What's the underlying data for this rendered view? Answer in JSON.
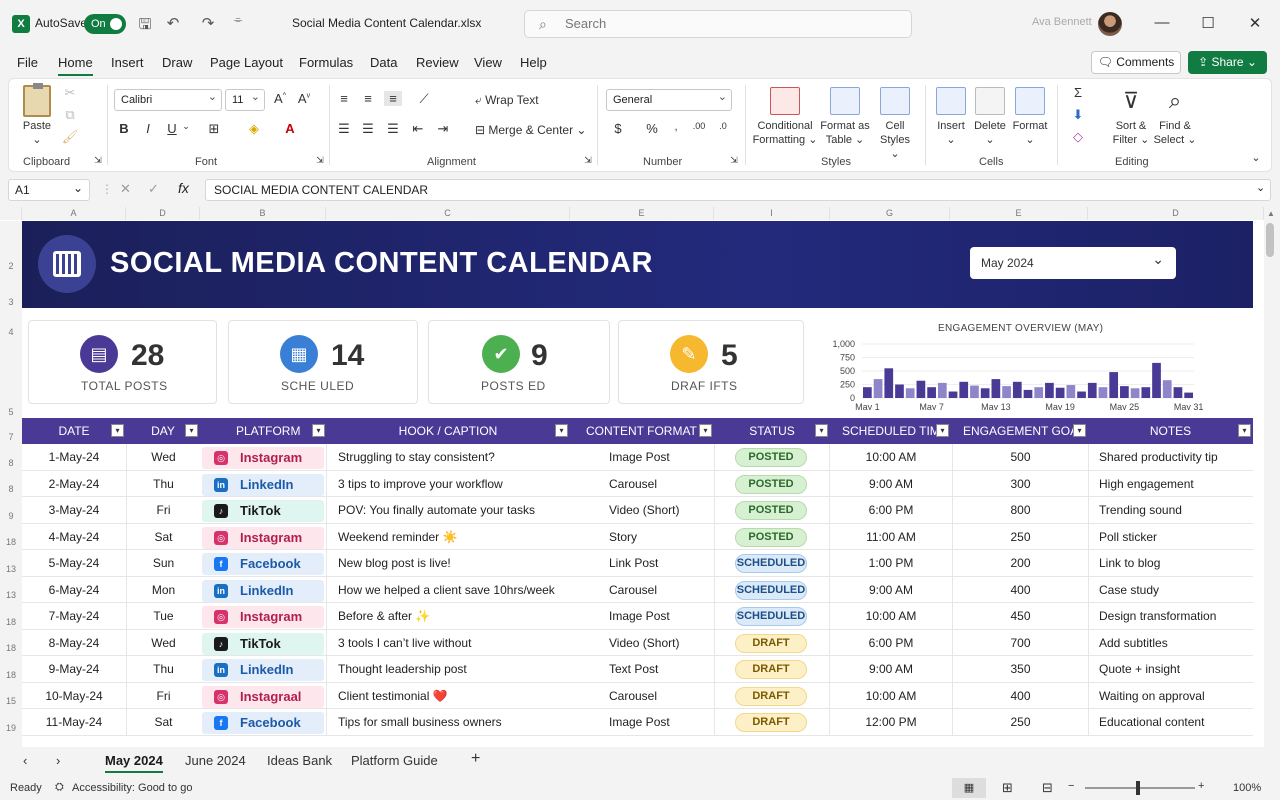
{
  "titlebar": {
    "autosave_label": "AutoSave",
    "autosave_state": "On",
    "filename": "Social Media Content Calendar.xlsx",
    "search_placeholder": "Search",
    "user_name": "Ava Bennett"
  },
  "menu": {
    "items": [
      "File",
      "Home",
      "Insert",
      "Draw",
      "Page Layout",
      "Formulas",
      "Data",
      "Review",
      "View",
      "Help"
    ],
    "active": "Home",
    "comments": "Comments",
    "share": "Share"
  },
  "ribbon": {
    "clipboard": {
      "paste": "Paste",
      "label": "Clipboard"
    },
    "font": {
      "family": "Calibri",
      "size": "11",
      "label": "Font"
    },
    "alignment": {
      "wrap": "Wrap Text",
      "merge": "Merge & Center",
      "label": "Alignment"
    },
    "number": {
      "format": "General",
      "label": "Number"
    },
    "styles": {
      "cond": "Conditional Formatting",
      "table": "Format as Table",
      "cell": "Cell Styles",
      "label": "Styles"
    },
    "cells": {
      "insert": "Insert",
      "delete": "Delete",
      "format": "Format",
      "label": "Cells"
    },
    "editing": {
      "sort": "Sort & Filter",
      "find": "Find & Select",
      "label": "Editing"
    }
  },
  "formula_bar": {
    "cell": "A1",
    "fx": "fx",
    "value": "SOCIAL MEDIA CONTENT CALENDAR"
  },
  "grid": {
    "col_headers": [
      "A",
      "D",
      "B",
      "C",
      "E",
      "I",
      "G",
      "E",
      "D"
    ],
    "row_headers": [
      "2",
      "3",
      "4",
      "5",
      "7",
      "8",
      "8",
      "9",
      "18",
      "13",
      "13",
      "18",
      "18",
      "18",
      "15",
      "19"
    ],
    "banner_title": "SOCIAL MEDIA CONTENT CALENDAR",
    "month": "May 2024",
    "kpis": [
      {
        "value": "28",
        "label": "TOTAL   POSTS",
        "color": "#4a3a96",
        "icon": "document-icon"
      },
      {
        "value": "14",
        "label": "SCHE    ULED",
        "color": "#3a7fd6",
        "icon": "calendar-icon"
      },
      {
        "value": "9",
        "label": "POSTS    ED",
        "color": "#4caf50",
        "icon": "check-icon"
      },
      {
        "value": "5",
        "label": "DRAF   IFTS",
        "color": "#f5b82e",
        "icon": "pencil-icon"
      }
    ],
    "headers": [
      "DATE",
      "DAY",
      "PLATFORM",
      "HOOK / CAPTION",
      "CONTENT FORMAT",
      "STATUS",
      "SCHEDULED TIME",
      "ENGAGEMENT GOAL",
      "NOTES"
    ],
    "rows": [
      {
        "date": "1-May-24",
        "day": "Wed",
        "platform": "Instagram",
        "caption": "Struggling to stay consistent?",
        "format": "Image Post",
        "status": "POSTED",
        "time": "10:00 AM",
        "goal": "500",
        "notes": "Shared productivity tip"
      },
      {
        "date": "2-May-24",
        "day": "Thu",
        "platform": "LinkedIn",
        "caption": "3 tips to improve your workflow",
        "format": "Carousel",
        "status": "POSTED",
        "time": "9:00 AM",
        "goal": "300",
        "notes": "High engagement"
      },
      {
        "date": "3-May-24",
        "day": "Fri",
        "platform": "TikTok",
        "caption": "POV: You finally automate your tasks",
        "format": "Video (Short)",
        "status": "POSTED",
        "time": "6:00 PM",
        "goal": "800",
        "notes": "Trending sound"
      },
      {
        "date": "4-May-24",
        "day": "Sat",
        "platform": "Instagram",
        "caption": "Weekend reminder ☀️",
        "format": "Story",
        "status": "POSTED",
        "time": "11:00 AM",
        "goal": "250",
        "notes": "Poll sticker"
      },
      {
        "date": "5-May-24",
        "day": "Sun",
        "platform": "Facebook",
        "caption": "New blog post is live!",
        "format": "Link Post",
        "status": "SCHEDULED",
        "time": "1:00 PM",
        "goal": "200",
        "notes": "Link to blog"
      },
      {
        "date": "6-May-24",
        "day": "Mon",
        "platform": "LinkedIn",
        "caption": "How we helped a client save 10hrs/week",
        "format": "Carousel",
        "status": "SCHEDULED",
        "time": "9:00 AM",
        "goal": "400",
        "notes": "Case study"
      },
      {
        "date": "7-May-24",
        "day": "Tue",
        "platform": "Instagram",
        "caption": "Before & after ✨",
        "format": "Image Post",
        "status": "SCHEDULED",
        "time": "10:00 AM",
        "goal": "450",
        "notes": "Design transformation"
      },
      {
        "date": "8-May-24",
        "day": "Wed",
        "platform": "TikTok",
        "caption": "3 tools I can’t live without",
        "format": "Video (Short)",
        "status": "DRAFT",
        "time": "6:00 PM",
        "goal": "700",
        "notes": "Add subtitles"
      },
      {
        "date": "9-May-24",
        "day": "Thu",
        "platform": "LinkedIn",
        "caption": "Thought leadership post",
        "format": "Text Post",
        "status": "DRAFT",
        "time": "9:00 AM",
        "goal": "350",
        "notes": "Quote + insight"
      },
      {
        "date": "10-May-24",
        "day": "Fri",
        "platform": "Instagraal",
        "caption": "Client testimonial ❤️",
        "format": "Carousel",
        "status": "DRAFT",
        "time": "10:00 AM",
        "goal": "400",
        "notes": "Waiting on approval"
      },
      {
        "date": "11-May-24",
        "day": "Sat",
        "platform": "Facebook",
        "caption": "Tips for small business owners",
        "format": "Image Post",
        "status": "DRAFT",
        "time": "12:00 PM",
        "goal": "250",
        "notes": "Educational content"
      }
    ]
  },
  "chart_data": {
    "type": "bar",
    "title": "ENGAGEMENT OVERVIEW (MAY)",
    "xticks": [
      "May 1",
      "May 7",
      "May 13",
      "May 19",
      "May 25",
      "May 31"
    ],
    "yticks": [
      "1,000",
      "750",
      "500",
      "250",
      "0"
    ],
    "ylim": [
      0,
      1000
    ],
    "x": [
      1,
      2,
      3,
      4,
      5,
      6,
      7,
      8,
      9,
      10,
      11,
      12,
      13,
      14,
      15,
      16,
      17,
      18,
      19,
      20,
      21,
      22,
      23,
      24,
      25,
      26,
      27,
      28,
      29,
      30,
      31
    ],
    "values": [
      200,
      350,
      550,
      250,
      180,
      320,
      200,
      280,
      120,
      300,
      230,
      180,
      350,
      220,
      300,
      150,
      200,
      280,
      190,
      240,
      120,
      280,
      200,
      480,
      220,
      180,
      200,
      650,
      330,
      200,
      100
    ]
  },
  "tabs": {
    "sheets": [
      "May 2024",
      "June 2024",
      "Ideas Bank",
      "Platform Guide"
    ],
    "active": "May 2024",
    "add": "+"
  },
  "status": {
    "ready": "Ready",
    "accessibility": "Accessibility: Good to go",
    "zoom": "100%"
  },
  "colors": {
    "excel_green": "#107c41",
    "header_purple": "#4a3a96",
    "banner": "#1f2570"
  }
}
